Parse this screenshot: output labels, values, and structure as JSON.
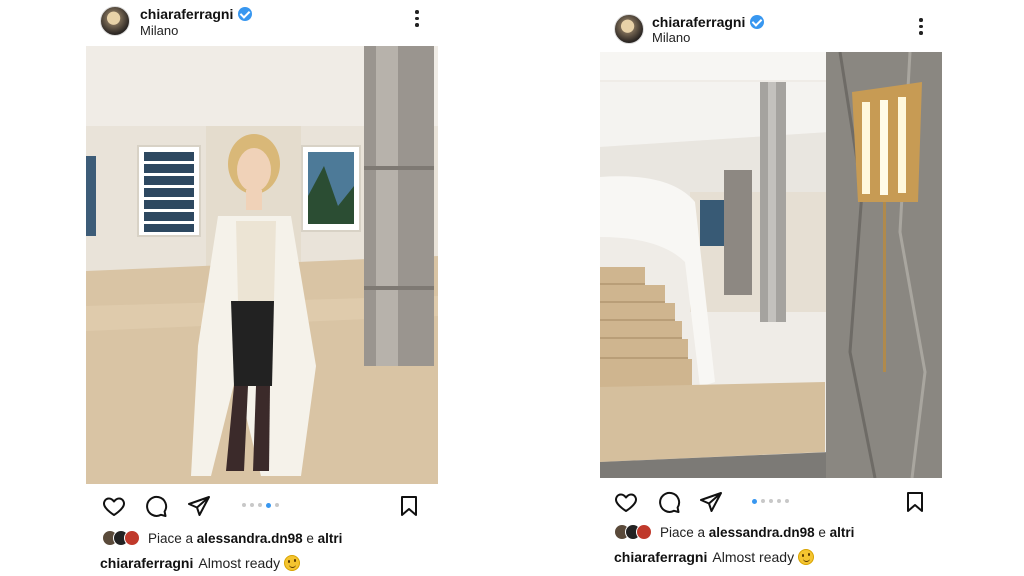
{
  "posts": [
    {
      "user": {
        "username": "chiaraferragni",
        "location": "Milano",
        "verified": true
      },
      "carousel": {
        "count": 5,
        "active_index": 3
      },
      "likes": {
        "prefix": "Piace a",
        "user": "alessandra.dn98",
        "joiner": "e",
        "suffix": "altri"
      },
      "caption": {
        "username": "chiaraferragni",
        "text": "Almost ready"
      },
      "icons": [
        "heart-icon",
        "comment-icon",
        "share-icon",
        "bookmark-icon",
        "more-icon",
        "verified-badge-icon",
        "smiling-face-emoji"
      ]
    },
    {
      "user": {
        "username": "chiaraferragni",
        "location": "Milano",
        "verified": true
      },
      "carousel": {
        "count": 5,
        "active_index": 0
      },
      "likes": {
        "prefix": "Piace a",
        "user": "alessandra.dn98",
        "joiner": "e",
        "suffix": "altri"
      },
      "caption": {
        "username": "chiaraferragni",
        "text": "Almost ready"
      },
      "icons": [
        "heart-icon",
        "comment-icon",
        "share-icon",
        "bookmark-icon",
        "more-icon",
        "verified-badge-icon",
        "smiling-face-emoji"
      ]
    }
  ],
  "colors": {
    "verified_blue": "#3897f0",
    "text": "#111111",
    "inactive_dot": "#c8c8c8"
  }
}
